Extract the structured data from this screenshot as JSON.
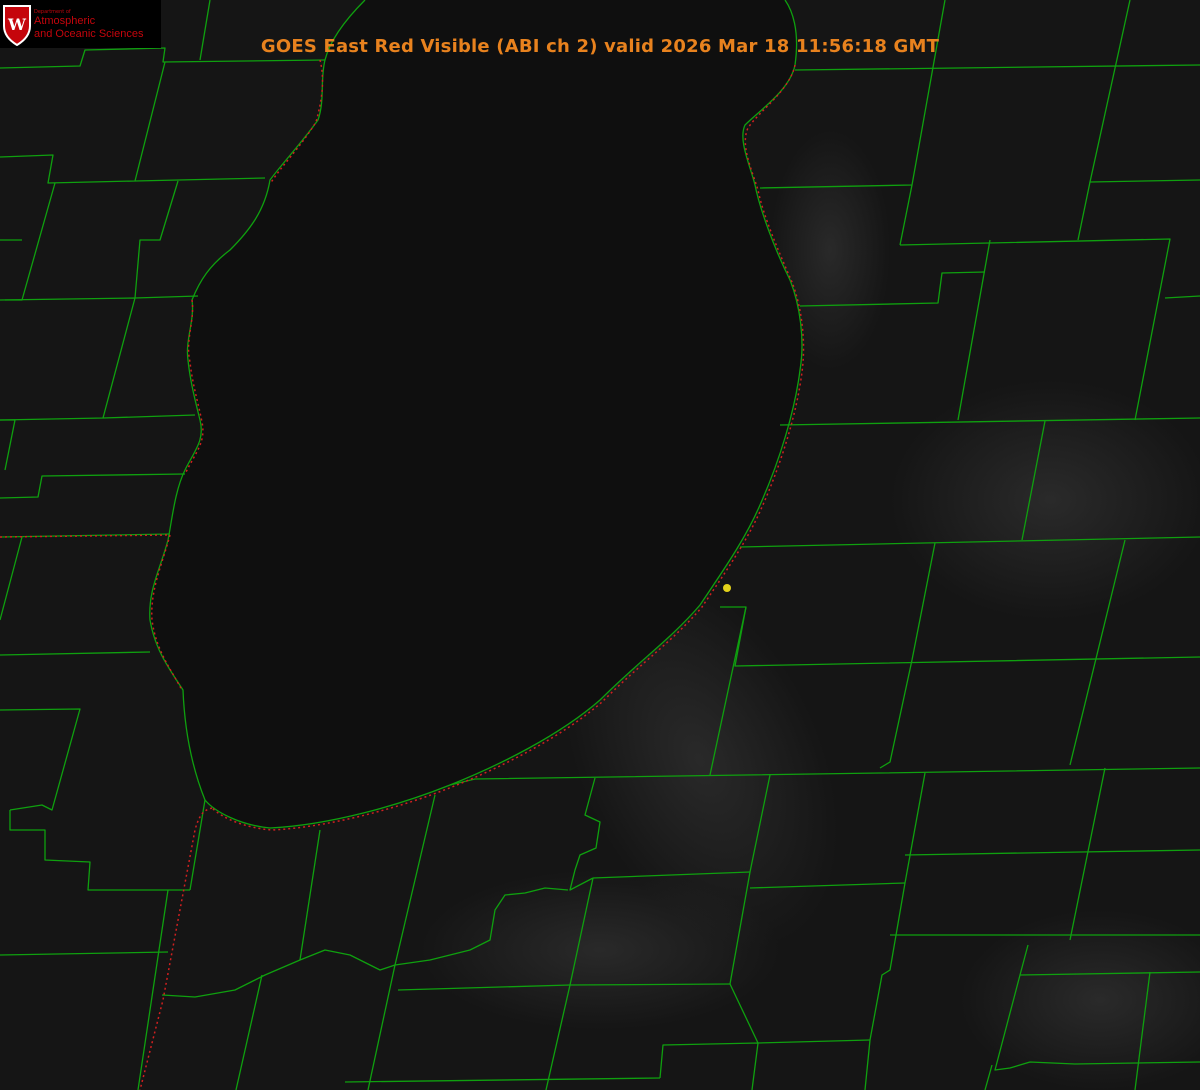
{
  "title": "GOES East Red Visible (ABI ch 2) valid 2026 Mar 18 11:56:18 GMT",
  "logo": {
    "dept_line": "Department of",
    "line1": "Atmospheric",
    "line2": "and Oceanic Sciences",
    "crest_letter": "W"
  },
  "colors": {
    "background": "#141414",
    "lake": "#101010",
    "county_lines": "#0fa00f",
    "state_line": "#c81e1e",
    "title": "#e8821e",
    "marker": "#e3d21b",
    "brand": "#c5050c"
  },
  "map": {
    "layers": [
      "county-boundaries",
      "state-boundary",
      "lake-shoreline",
      "station-marker"
    ]
  }
}
